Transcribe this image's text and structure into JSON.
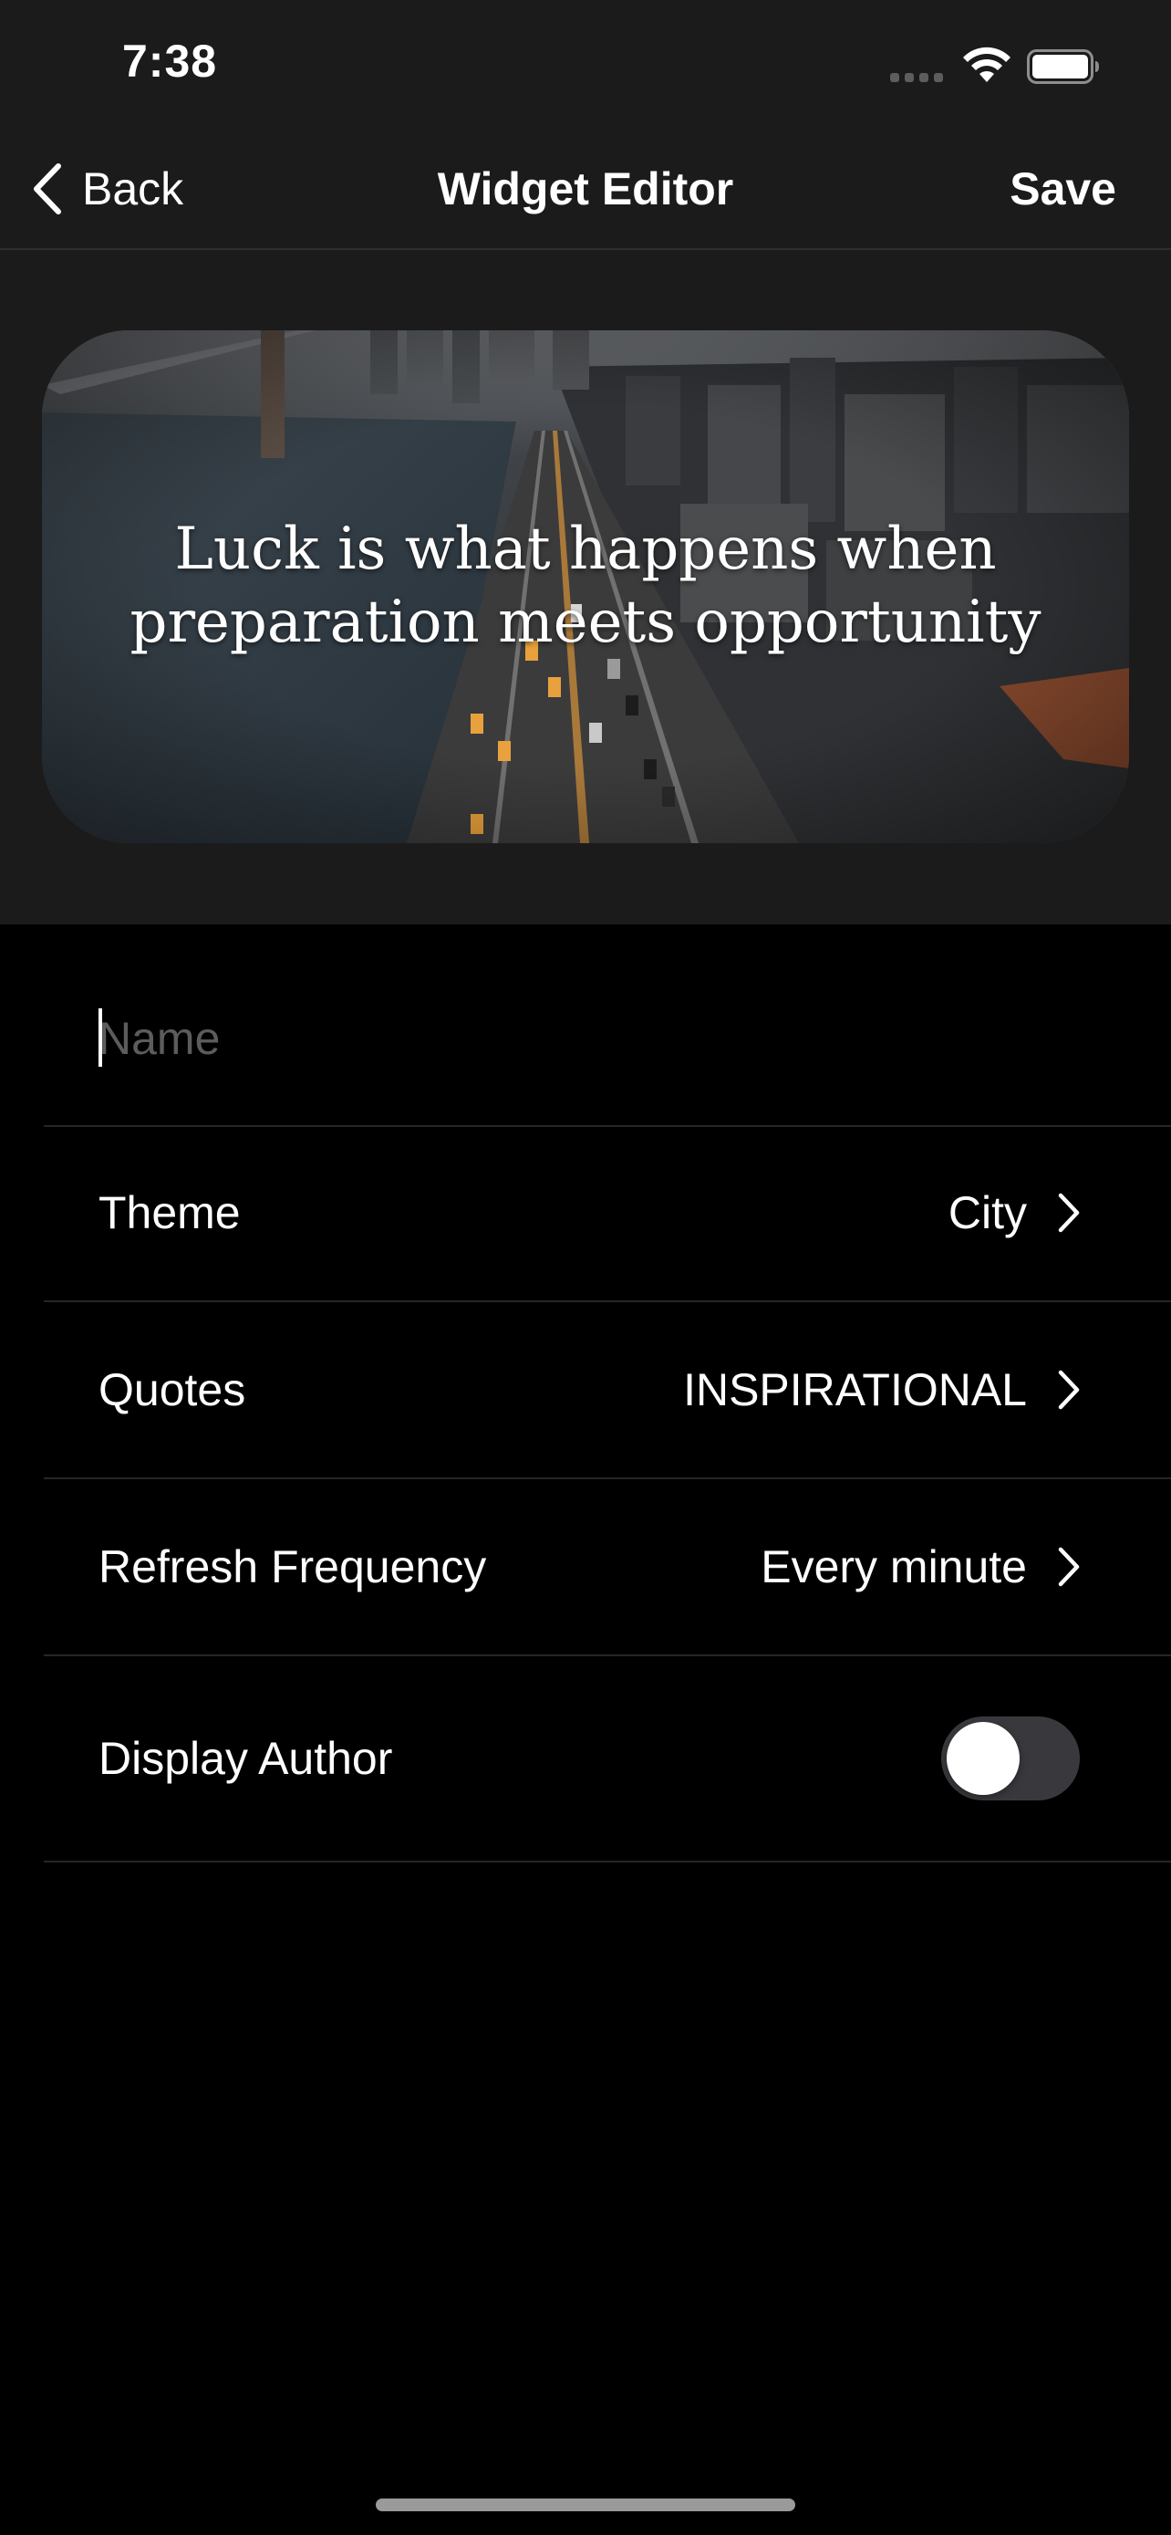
{
  "status_bar": {
    "time": "7:38"
  },
  "nav": {
    "back_label": "Back",
    "title": "Widget Editor",
    "save_label": "Save"
  },
  "widget": {
    "quote": "Luck is what happens when preparation meets opportunity"
  },
  "form": {
    "name": {
      "placeholder": "Name",
      "value": ""
    },
    "rows": [
      {
        "label": "Theme",
        "value": "City"
      },
      {
        "label": "Quotes",
        "value": "INSPIRATIONAL"
      },
      {
        "label": "Refresh Frequency",
        "value": "Every minute"
      }
    ],
    "display_author": {
      "label": "Display Author",
      "on": false
    }
  },
  "colors": {
    "top_background": "#1b1b1b",
    "background": "#000000",
    "separator": "#262626",
    "toggle_off": "#39393d",
    "placeholder": "#5c5c5c"
  },
  "icons": [
    "back-chevron-icon",
    "chevron-right-icon",
    "wifi-icon",
    "battery-icon",
    "cellular-signal-icon"
  ]
}
